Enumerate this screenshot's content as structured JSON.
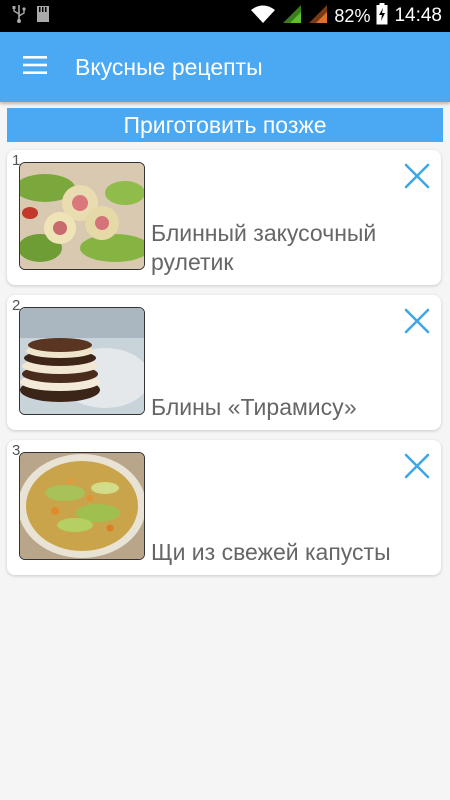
{
  "status_bar": {
    "battery_percent": "82%",
    "time": "14:48",
    "icons": [
      "usb-icon",
      "sd-card-icon",
      "wifi-icon",
      "signal-icon",
      "signal-icon-2",
      "battery-charging-icon"
    ]
  },
  "app_bar": {
    "title": "Вкусные рецепты",
    "menu_icon": "hamburger-menu-icon",
    "color": "#4ba9f4"
  },
  "section": {
    "title": "Приготовить позже"
  },
  "recipes": [
    {
      "index": "1",
      "title": "Блинный закусочный рулетик",
      "remove_icon": "close-icon"
    },
    {
      "index": "2",
      "title": "Блины «Тирамису»",
      "remove_icon": "close-icon"
    },
    {
      "index": "3",
      "title": "Щи из свежей капусты",
      "remove_icon": "close-icon"
    }
  ],
  "colors": {
    "accent": "#4ba9f4",
    "remove_icon": "#3fa7e6"
  }
}
